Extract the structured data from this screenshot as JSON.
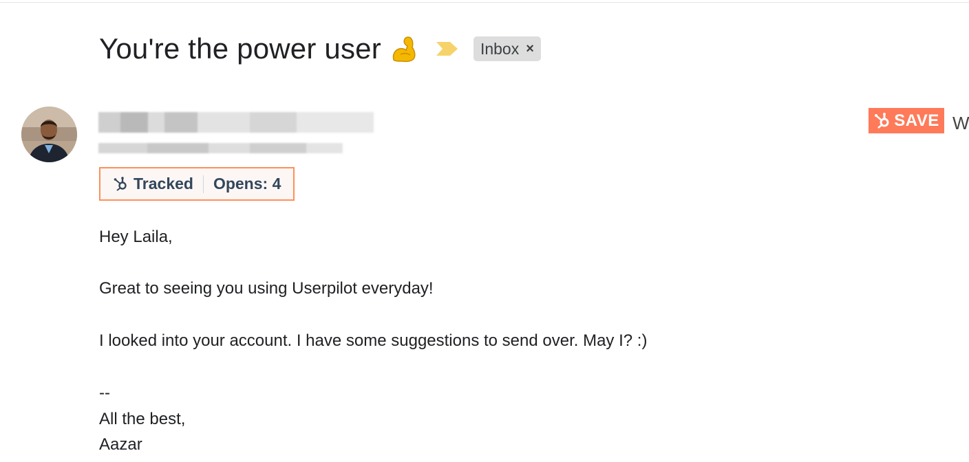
{
  "subject": {
    "title": "You're the power user",
    "emoji": "flexed-biceps",
    "label_chip": "Inbox",
    "label_remove": "×"
  },
  "sender": {
    "avatar": "person-avatar",
    "name_redacted": true
  },
  "hubspot": {
    "save_label": "SAVE",
    "cut_off_text": "We",
    "tracked_label": "Tracked",
    "opens_label": "Opens: 4",
    "accent_color": "#ff7a59"
  },
  "message": {
    "greeting": "Hey Laila,",
    "line1": "Great to seeing you using Userpilot everyday!",
    "line2": "I looked into your account. I have some suggestions to send over. May I? :)",
    "sig_sep": "--",
    "sign_off": "All the best,",
    "signature": "Aazar"
  }
}
